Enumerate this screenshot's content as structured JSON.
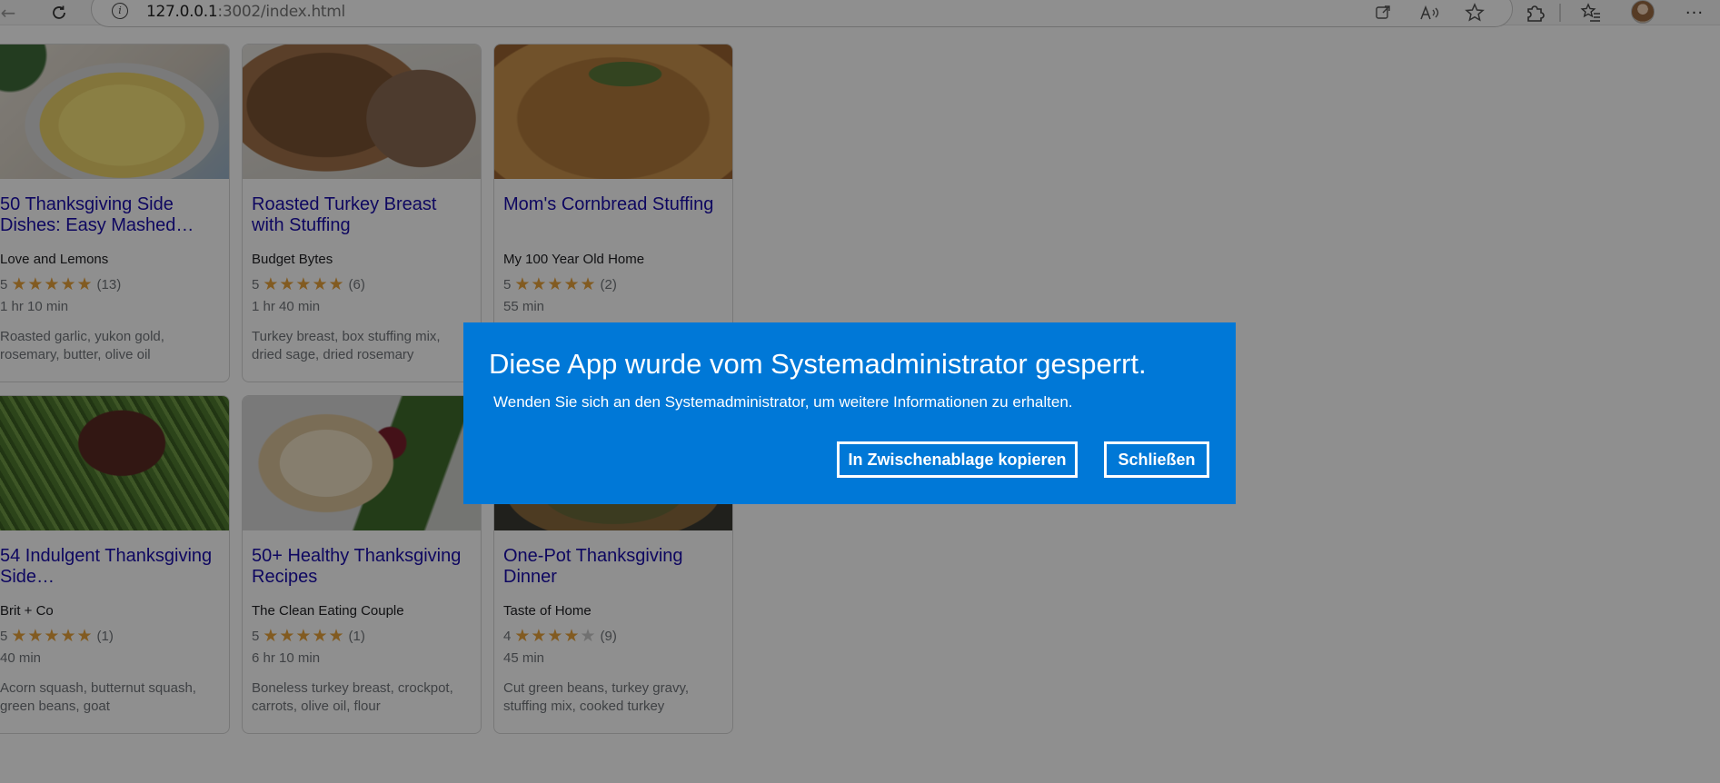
{
  "browser": {
    "url_host": "127.0.0.1",
    "url_rest": ":3002/index.html"
  },
  "cards": [
    {
      "title": "50 Thanksgiving Side Dishes: Easy Mashed…",
      "source": "Love and Lemons",
      "rating": "5",
      "stars": 5,
      "count": "(13)",
      "time": "1 hr 10 min",
      "ingredients": "Roasted garlic, yukon gold, rosemary, butter, olive oil"
    },
    {
      "title": "Roasted Turkey Breast with Stuffing",
      "source": "Budget Bytes",
      "rating": "5",
      "stars": 5,
      "count": "(6)",
      "time": "1 hr 40 min",
      "ingredients": "Turkey breast, box stuffing mix, dried sage, dried rosemary"
    },
    {
      "title": "Mom's Cornbread Stuffing",
      "source": "My 100 Year Old Home",
      "rating": "5",
      "stars": 5,
      "count": "(2)",
      "time": "55 min",
      "ingredients": ""
    },
    {
      "title": "54 Indulgent Thanksgiving Side…",
      "source": "Brit + Co",
      "rating": "5",
      "stars": 5,
      "count": "(1)",
      "time": "40 min",
      "ingredients": "Acorn squash, butternut squash, green beans, goat"
    },
    {
      "title": "50+ Healthy Thanksgiving Recipes",
      "source": "The Clean Eating Couple",
      "rating": "5",
      "stars": 5,
      "count": "(1)",
      "time": "6 hr 10 min",
      "ingredients": "Boneless turkey breast, crockpot, carrots, olive oil, flour"
    },
    {
      "title": "One-Pot Thanksgiving Dinner",
      "source": "Taste of Home",
      "rating": "4",
      "stars": 4,
      "count": "(9)",
      "time": "45 min",
      "ingredients": "Cut green beans, turkey gravy, stuffing mix, cooked turkey"
    }
  ],
  "dialog": {
    "title": "Diese App wurde vom Systemadministrator gesperrt.",
    "message": "Wenden Sie sich an den Systemadministrator, um weitere Informationen zu erhalten.",
    "copy_label": "In Zwischenablage kopieren",
    "close_label": "Schließen"
  },
  "colors": {
    "dialog_bg": "#0078d7",
    "link": "#1a0dab",
    "star": "#e8a33b"
  }
}
